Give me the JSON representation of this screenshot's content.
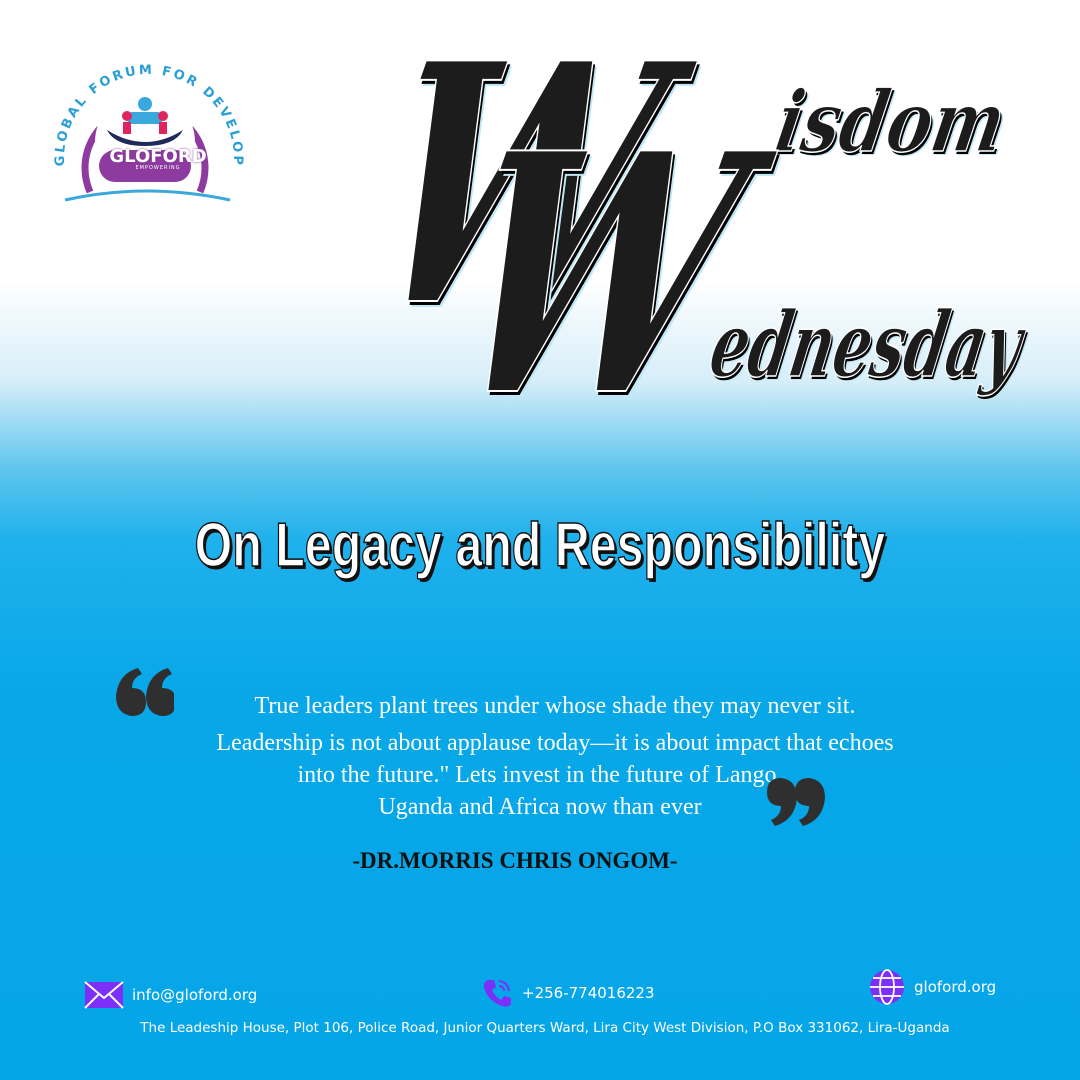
{
  "brand": {
    "org_arc_text": "GLOBAL FORUM FOR DEVELOPMENT",
    "name": "GLOFORD",
    "tagline": "EMPOWERING"
  },
  "heading": {
    "initial_1": "W",
    "rest_1": "isdom",
    "initial_2": "W",
    "rest_2": "ednesday"
  },
  "subtitle": "On Legacy and Responsibility",
  "quote": {
    "lines": [
      "True leaders plant trees under whose shade they may never sit.",
      "Leadership is not about applause today—it is about impact that echoes",
      "into the future.\" Lets invest in the future of Lango,",
      "Uganda and Africa now than ever"
    ],
    "author": "-DR.MORRIS CHRIS ONGOM-"
  },
  "footer": {
    "email": "info@gloford.org",
    "phone": "+256-774016223",
    "website": "gloford.org",
    "address": "The Leadeship House, Plot 106, Police Road, Junior Quarters Ward, Lira City West Division, P.O Box 331062, Lira-Uganda"
  },
  "colors": {
    "background_top": "#ffffff",
    "background_bottom": "#05a6e8",
    "logo_purple": "#8e3b9f",
    "logo_blue": "#3aa7dd",
    "heading_fill": "#1c1c1c",
    "icon_purple": "#7b2ff7"
  },
  "icons": [
    "envelope-icon",
    "phone-icon",
    "globe-icon",
    "open-quote-icon",
    "close-quote-icon"
  ]
}
